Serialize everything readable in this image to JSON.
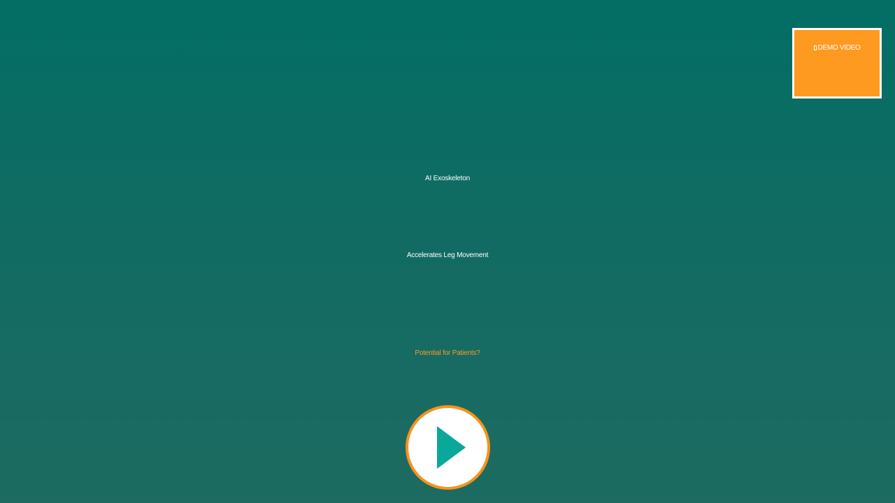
{
  "badge": {
    "label": "DEMO VIDEO",
    "icon": "film-icon"
  },
  "content": {
    "title": "AI Exoskeleton",
    "subtitle": "Accelerates Leg Movement",
    "question": "Potential for Patients?"
  },
  "play_button": {
    "icon": "play-icon"
  },
  "colors": {
    "accent": "#ff9a20",
    "play_triangle": "#0aa89a",
    "background_top": "#036e64",
    "background_bottom": "#1d6b61",
    "text": "#ffffff"
  }
}
